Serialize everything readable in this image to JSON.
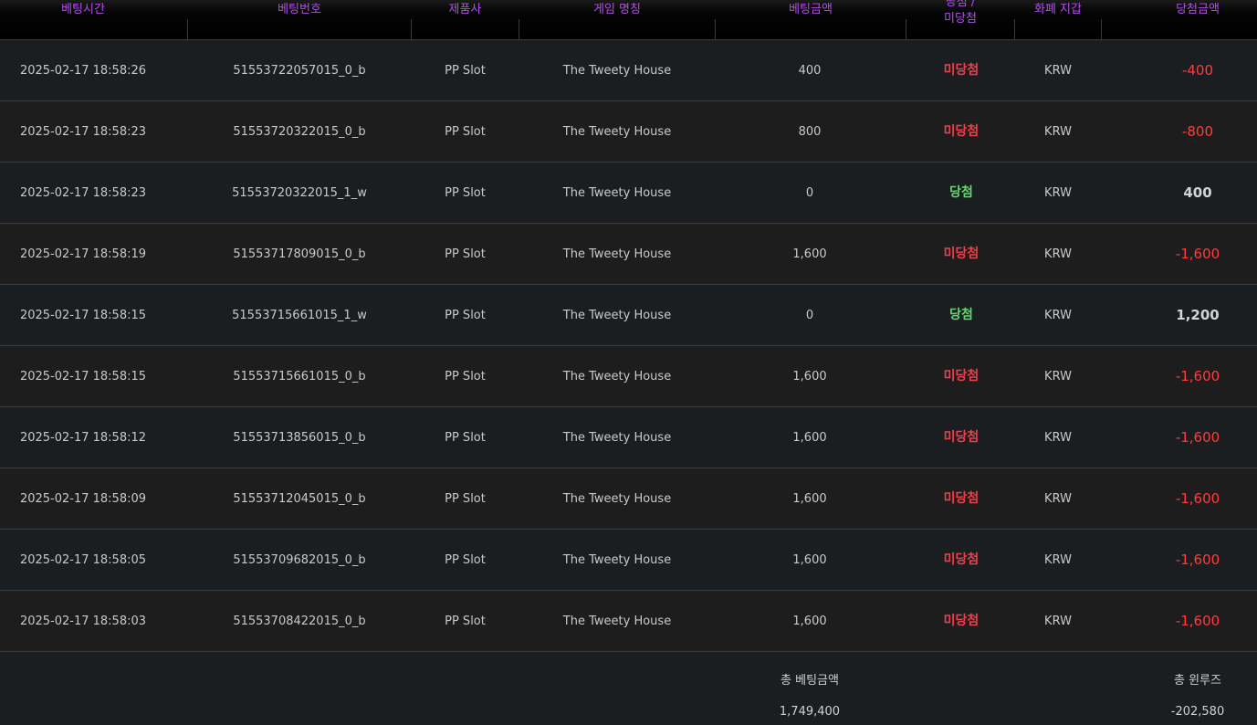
{
  "colors": {
    "header_text": "#b44cf0",
    "lose": "#e8414c",
    "win": "#62d86c",
    "negative_amount": "#ff3b3b"
  },
  "headers": {
    "bet_time": "베팅시간",
    "bet_number": "베팅번호",
    "provider": "제품사",
    "game_name": "게임 명칭",
    "bet_amount": "베팅금액",
    "result_line1": "당첨 /",
    "result_line2": "미당첨",
    "currency": "화폐 지갑",
    "win_amount": "당첨금액"
  },
  "rows": [
    {
      "time": "2025-02-17 18:58:26",
      "bet_id": "51553722057015_0_b",
      "provider": "PP Slot",
      "game": "The Tweety House",
      "bet_amount": "400",
      "result": "미당첨",
      "currency": "KRW",
      "win_amount": "-400"
    },
    {
      "time": "2025-02-17 18:58:23",
      "bet_id": "51553720322015_0_b",
      "provider": "PP Slot",
      "game": "The Tweety House",
      "bet_amount": "800",
      "result": "미당첨",
      "currency": "KRW",
      "win_amount": "-800"
    },
    {
      "time": "2025-02-17 18:58:23",
      "bet_id": "51553720322015_1_w",
      "provider": "PP Slot",
      "game": "The Tweety House",
      "bet_amount": "0",
      "result": "당첨",
      "currency": "KRW",
      "win_amount": "400"
    },
    {
      "time": "2025-02-17 18:58:19",
      "bet_id": "51553717809015_0_b",
      "provider": "PP Slot",
      "game": "The Tweety House",
      "bet_amount": "1,600",
      "result": "미당첨",
      "currency": "KRW",
      "win_amount": "-1,600"
    },
    {
      "time": "2025-02-17 18:58:15",
      "bet_id": "51553715661015_1_w",
      "provider": "PP Slot",
      "game": "The Tweety House",
      "bet_amount": "0",
      "result": "당첨",
      "currency": "KRW",
      "win_amount": "1,200"
    },
    {
      "time": "2025-02-17 18:58:15",
      "bet_id": "51553715661015_0_b",
      "provider": "PP Slot",
      "game": "The Tweety House",
      "bet_amount": "1,600",
      "result": "미당첨",
      "currency": "KRW",
      "win_amount": "-1,600"
    },
    {
      "time": "2025-02-17 18:58:12",
      "bet_id": "51553713856015_0_b",
      "provider": "PP Slot",
      "game": "The Tweety House",
      "bet_amount": "1,600",
      "result": "미당첨",
      "currency": "KRW",
      "win_amount": "-1,600"
    },
    {
      "time": "2025-02-17 18:58:09",
      "bet_id": "51553712045015_0_b",
      "provider": "PP Slot",
      "game": "The Tweety House",
      "bet_amount": "1,600",
      "result": "미당첨",
      "currency": "KRW",
      "win_amount": "-1,600"
    },
    {
      "time": "2025-02-17 18:58:05",
      "bet_id": "51553709682015_0_b",
      "provider": "PP Slot",
      "game": "The Tweety House",
      "bet_amount": "1,600",
      "result": "미당첨",
      "currency": "KRW",
      "win_amount": "-1,600"
    },
    {
      "time": "2025-02-17 18:58:03",
      "bet_id": "51553708422015_0_b",
      "provider": "PP Slot",
      "game": "The Tweety House",
      "bet_amount": "1,600",
      "result": "미당첨",
      "currency": "KRW",
      "win_amount": "-1,600"
    }
  ],
  "summary": {
    "total_bet_label": "총 베팅금액",
    "total_bet_value": "1,749,400",
    "total_winloss_label": "총 윈루즈",
    "total_winloss_value": "-202,580"
  }
}
